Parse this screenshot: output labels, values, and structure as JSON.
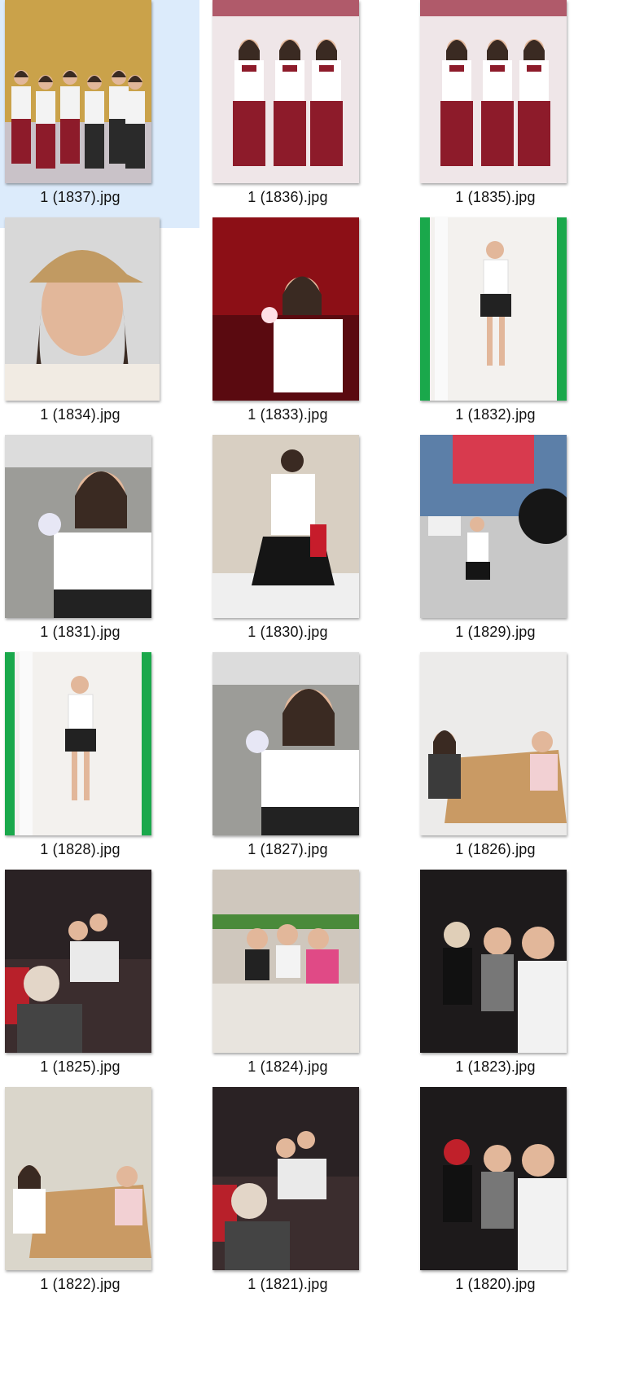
{
  "window": {
    "title": ""
  },
  "files": [
    {
      "name": "1 (1837).jpg",
      "selected": true,
      "scene": "group-school",
      "colors": [
        "#caa24a",
        "#8d1b2a",
        "#f3f3f3"
      ]
    },
    {
      "name": "1 (1836).jpg",
      "selected": false,
      "scene": "trio-school",
      "colors": [
        "#efe6e8",
        "#8d1b2a",
        "#ffffff"
      ]
    },
    {
      "name": "1 (1835).jpg",
      "selected": false,
      "scene": "trio-school",
      "colors": [
        "#efe6e8",
        "#8d1b2a",
        "#ffffff"
      ]
    },
    {
      "name": "1 (1834).jpg",
      "selected": false,
      "scene": "selfie-cap",
      "colors": [
        "#d8d8d8",
        "#c19a62",
        "#f1ebe3"
      ]
    },
    {
      "name": "1 (1833).jpg",
      "selected": false,
      "scene": "concert",
      "colors": [
        "#8c0f16",
        "#d62228",
        "#ffffff"
      ]
    },
    {
      "name": "1 (1832).jpg",
      "selected": false,
      "scene": "mirror",
      "colors": [
        "#1aa84b",
        "#f3f1ee",
        "#222222"
      ]
    },
    {
      "name": "1 (1831).jpg",
      "selected": false,
      "scene": "car-selfie",
      "colors": [
        "#9c9c98",
        "#ffffff",
        "#222222"
      ]
    },
    {
      "name": "1 (1830).jpg",
      "selected": false,
      "scene": "mall-back",
      "colors": [
        "#d8cfc2",
        "#ffffff",
        "#151515"
      ]
    },
    {
      "name": "1 (1829).jpg",
      "selected": false,
      "scene": "parking",
      "colors": [
        "#5c7fa8",
        "#ffffff",
        "#151515"
      ]
    },
    {
      "name": "1 (1828).jpg",
      "selected": false,
      "scene": "mirror",
      "colors": [
        "#1aa84b",
        "#f3f1ee",
        "#222222"
      ]
    },
    {
      "name": "1 (1827).jpg",
      "selected": false,
      "scene": "car-selfie",
      "colors": [
        "#9c9c98",
        "#ffffff",
        "#222222"
      ]
    },
    {
      "name": "1 (1826).jpg",
      "selected": false,
      "scene": "cafe-table",
      "colors": [
        "#ecebea",
        "#c99a64",
        "#3b3b3b"
      ]
    },
    {
      "name": "1 (1825).jpg",
      "selected": false,
      "scene": "cinema",
      "colors": [
        "#2a2224",
        "#b8202a",
        "#e3d6c8"
      ]
    },
    {
      "name": "1 (1824).jpg",
      "selected": false,
      "scene": "cafe-plants",
      "colors": [
        "#cfc7bd",
        "#e8e4de",
        "#e04a86"
      ]
    },
    {
      "name": "1 (1823).jpg",
      "selected": false,
      "scene": "cinema-three",
      "colors": [
        "#1d1a1b",
        "#e0cfb8",
        "#f2f2f2"
      ]
    },
    {
      "name": "1 (1822).jpg",
      "selected": false,
      "scene": "cafe-table",
      "colors": [
        "#dad6cb",
        "#c99a64",
        "#ffffff"
      ]
    },
    {
      "name": "1 (1821).jpg",
      "selected": false,
      "scene": "cinema",
      "colors": [
        "#2a2224",
        "#b8202a",
        "#e3d6c8"
      ]
    },
    {
      "name": "1 (1820).jpg",
      "selected": false,
      "scene": "cinema-three",
      "colors": [
        "#1d1a1b",
        "#c0202a",
        "#f2f2f2"
      ]
    }
  ]
}
